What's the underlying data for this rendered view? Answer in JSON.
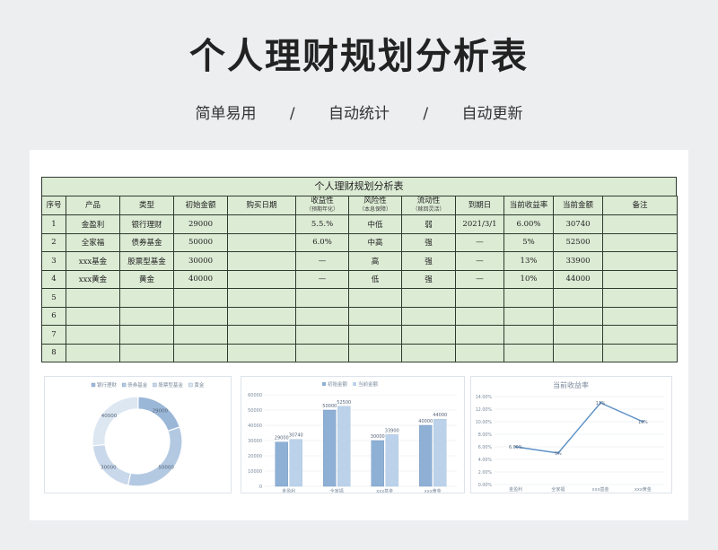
{
  "page": {
    "title": "个人理财规划分析表",
    "tags": [
      "简单易用",
      "/",
      "自动统计",
      "/",
      "自动更新"
    ]
  },
  "table": {
    "title": "个人理财规划分析表",
    "headers": [
      {
        "label": "序号",
        "sub": ""
      },
      {
        "label": "产品",
        "sub": ""
      },
      {
        "label": "类型",
        "sub": ""
      },
      {
        "label": "初始金额",
        "sub": ""
      },
      {
        "label": "购买日期",
        "sub": ""
      },
      {
        "label": "收益性",
        "sub": "（预期年化）"
      },
      {
        "label": "风险性",
        "sub": "（本息保障）"
      },
      {
        "label": "流动性",
        "sub": "（赎回灵活）"
      },
      {
        "label": "到期日",
        "sub": ""
      },
      {
        "label": "当前收益率",
        "sub": ""
      },
      {
        "label": "当前金额",
        "sub": ""
      },
      {
        "label": "备注",
        "sub": ""
      }
    ],
    "rows": [
      [
        "1",
        "金盈利",
        "银行理财",
        "29000",
        "",
        "5.5.%",
        "中低",
        "弱",
        "2021/3/1",
        "6.00%",
        "30740",
        ""
      ],
      [
        "2",
        "全家福",
        "债券基金",
        "50000",
        "",
        "6.0%",
        "中高",
        "强",
        "—",
        "5%",
        "52500",
        ""
      ],
      [
        "3",
        "xxx基金",
        "股票型基金",
        "30000",
        "",
        "—",
        "高",
        "强",
        "—",
        "13%",
        "33900",
        ""
      ],
      [
        "4",
        "xxx黄金",
        "黄金",
        "40000",
        "",
        "—",
        "低",
        "强",
        "—",
        "10%",
        "44000",
        ""
      ],
      [
        "5",
        "",
        "",
        "",
        "",
        "",
        "",
        "",
        "",
        "",
        "",
        ""
      ],
      [
        "6",
        "",
        "",
        "",
        "",
        "",
        "",
        "",
        "",
        "",
        "",
        ""
      ],
      [
        "7",
        "",
        "",
        "",
        "",
        "",
        "",
        "",
        "",
        "",
        "",
        ""
      ],
      [
        "8",
        "",
        "",
        "",
        "",
        "",
        "",
        "",
        "",
        "",
        "",
        ""
      ]
    ]
  },
  "chart_data": [
    {
      "type": "pie",
      "variant": "donut",
      "legend": [
        "银行理财",
        "债券基金",
        "股票型基金",
        "黄金"
      ],
      "legend_position": "top",
      "values": [
        29000,
        50000,
        30000,
        40000
      ],
      "labels": [
        "29000",
        "50000",
        "30000",
        "40000"
      ],
      "colors": [
        "#9bb7d8",
        "#b3c9e2",
        "#c9d8ea",
        "#dde7f2"
      ]
    },
    {
      "type": "bar",
      "legend_position": "top",
      "categories": [
        "金盈利",
        "全家福",
        "xxx基金",
        "xxx黄金"
      ],
      "series": [
        {
          "name": "初始金额",
          "values": [
            29000,
            50000,
            30000,
            40000
          ],
          "color": "#8eb0d4"
        },
        {
          "name": "当前金额",
          "values": [
            30740,
            52500,
            33900,
            44000
          ],
          "color": "#bcd2ea"
        }
      ],
      "ylim": [
        0,
        60000
      ],
      "yticks": [
        "0",
        "10000",
        "20000",
        "30000",
        "40000",
        "50000",
        "60000"
      ],
      "grid": true
    },
    {
      "type": "line",
      "title": "当前收益率",
      "categories": [
        "金盈利",
        "全家福",
        "xxx基金",
        "xxx黄金"
      ],
      "series": [
        {
          "name": "当前收益率",
          "values": [
            6,
            5,
            13,
            10
          ],
          "labels": [
            "6.00%",
            "5%",
            "13%",
            "10%"
          ],
          "color": "#5b8fc4"
        }
      ],
      "ylim": [
        0,
        14
      ],
      "yticks": [
        "0.00%",
        "2.00%",
        "4.00%",
        "6.00%",
        "8.00%",
        "10.00%",
        "12.00%",
        "14.00%"
      ],
      "grid": true
    }
  ]
}
